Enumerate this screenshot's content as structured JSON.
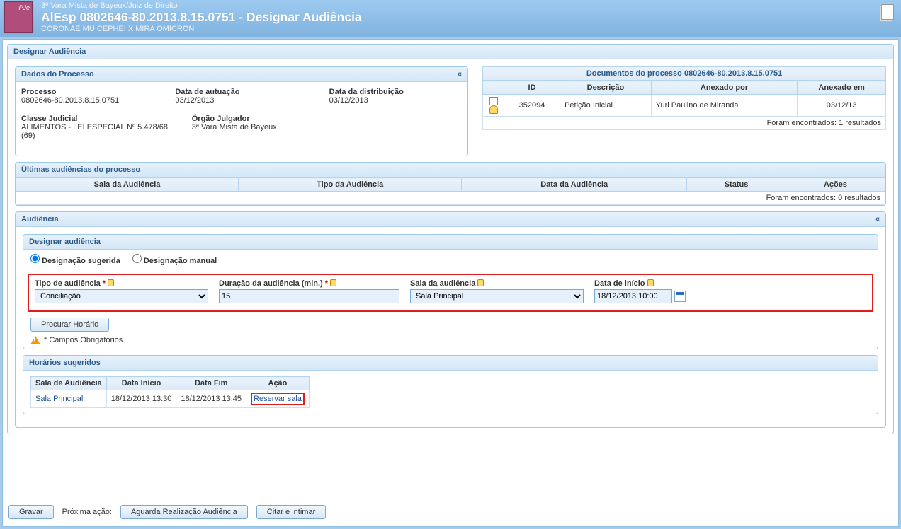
{
  "header": {
    "court": "3ª Vara Mista de Bayeux/Juiz de Direito",
    "title": "AlEsp 0802646-80.2013.8.15.0751 - Designar Audiência",
    "parties": "CORONAE MU CEPHEI X MIRA OMICRON"
  },
  "outerPanel": {
    "title": "Designar Audiência"
  },
  "processPanel": {
    "title": "Dados do Processo",
    "processoLabel": "Processo",
    "processoValue": "0802646-80.2013.8.15.0751",
    "autuacaoLabel": "Data de autuação",
    "autuacaoValue": "03/12/2013",
    "distribLabel": "Data da distribuição",
    "distribValue": "03/12/2013",
    "classeLabel": "Classe Judicial",
    "classeValue": "ALIMENTOS - LEI ESPECIAL Nº 5.478/68 (69)",
    "orgaoLabel": "Órgão Julgador",
    "orgaoValue": "3ª Vara Mista de Bayeux"
  },
  "docsPanel": {
    "heading": "Documentos do processo 0802646-80.2013.8.15.0751",
    "cols": {
      "id": "ID",
      "desc": "Descrição",
      "anexadoPor": "Anexado por",
      "anexadoEm": "Anexado em"
    },
    "row": {
      "id": "352094",
      "desc": "Petição Inicial",
      "anexadoPor": "Yuri Paulino de Miranda",
      "anexadoEm": "03/12/13"
    },
    "count": "Foram encontrados: 1 resultados"
  },
  "ultimasPanel": {
    "title": "Últimas audiências do processo",
    "cols": {
      "sala": "Sala da Audiência",
      "tipo": "Tipo da Audiência",
      "data": "Data da Audiência",
      "status": "Status",
      "acoes": "Ações"
    },
    "count": "Foram encontrados: 0 resultados"
  },
  "audienciaPanel": {
    "title": "Audiência",
    "designarTitle": "Designar audiência",
    "radioSugerida": "Designação sugerida",
    "radioManual": "Designação manual",
    "tipoLabel": "Tipo de audiência",
    "tipoValue": "Conciliação",
    "duracaoLabel": "Duração da audiência (min.)",
    "duracaoValue": "15",
    "salaLabel": "Sala da audiência",
    "salaValue": "Sala Principal",
    "dataLabel": "Data de início",
    "dataValue": "18/12/2013 10:00",
    "procurar": "Procurar Horário",
    "obrig": "* Campos Obrigatórios",
    "sugeridosTitle": "Horários sugeridos",
    "sugeridosCols": {
      "sala": "Sala de Audiência",
      "ini": "Data Início",
      "fim": "Data Fim",
      "acao": "Ação"
    },
    "sugeridosRow": {
      "sala": "Sala Principal",
      "ini": "18/12/2013 13:30",
      "fim": "18/12/2013 13:45",
      "acao": "Reservar sala"
    }
  },
  "footer": {
    "gravar": "Gravar",
    "proxima": "Próxima ação:",
    "aguarda": "Aguarda Realização Audiência",
    "citar": "Citar e intimar"
  }
}
